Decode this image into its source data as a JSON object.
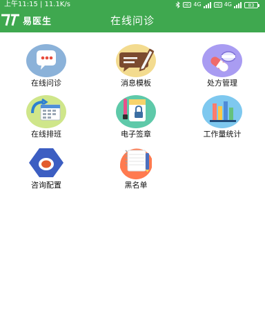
{
  "status_bar": {
    "left_text": "上午11:15 | 11.1K/s",
    "right_icons": [
      "bluetooth-icon",
      "hd-icon",
      "signal-icon",
      "hd-icon",
      "signal-icon",
      "battery-icon"
    ],
    "network_1": "4G",
    "network_2": "4G",
    "battery": "83"
  },
  "header": {
    "logo_text": "易医生",
    "title": "在线问诊",
    "background": "#3fa84f"
  },
  "menu": {
    "items": [
      {
        "label": "在线问诊",
        "icon": "chat-bubble-icon"
      },
      {
        "label": "消息模板",
        "icon": "message-template-icon"
      },
      {
        "label": "处方管理",
        "icon": "pill-prescription-icon"
      },
      {
        "label": "在线排班",
        "icon": "calendar-schedule-icon"
      },
      {
        "label": "电子签章",
        "icon": "lock-seal-icon"
      },
      {
        "label": "工作量统计",
        "icon": "book-stats-icon"
      },
      {
        "label": "咨询配置",
        "icon": "config-hexagon-icon"
      },
      {
        "label": "黑名单",
        "icon": "blacklist-notebook-icon"
      }
    ]
  }
}
